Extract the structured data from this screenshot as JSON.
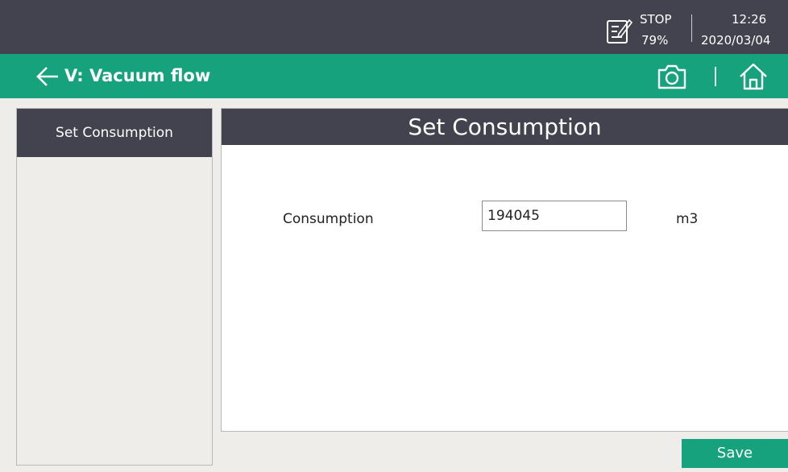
{
  "status_bar": {
    "state": "STOP",
    "percent": "79%",
    "time": "12:26",
    "date": "2020/03/04",
    "status_icon": "note-edit-icon"
  },
  "header": {
    "title": "V: Vacuum flow",
    "back_icon": "arrow-left-icon",
    "camera_icon": "camera-icon",
    "home_icon": "home-icon",
    "accent_color": "#16a27d",
    "dark_color": "#434350"
  },
  "sidebar": {
    "items": [
      {
        "label": "Set Consumption",
        "selected": true
      }
    ]
  },
  "main": {
    "panel_title": "Set Consumption",
    "fields": [
      {
        "label": "Consumption",
        "value": "194045",
        "unit": "m3"
      }
    ]
  },
  "footer": {
    "save_label": "Save"
  }
}
